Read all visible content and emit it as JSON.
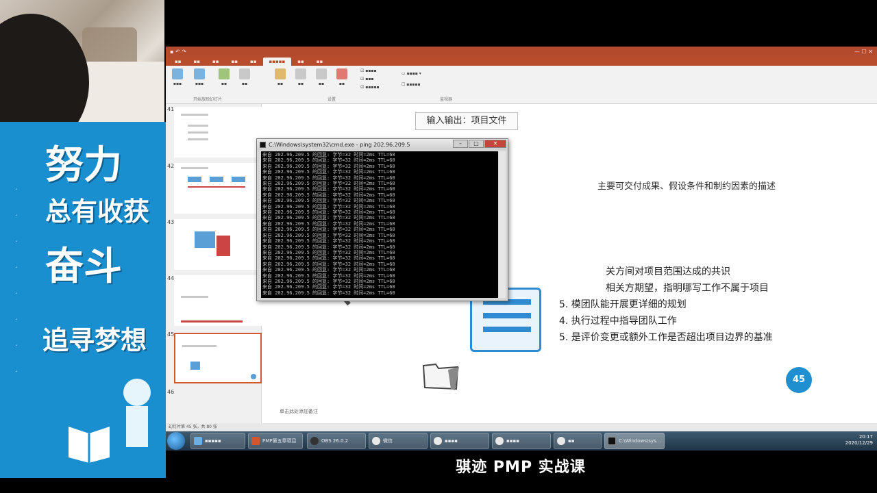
{
  "banner": {
    "line1": "努力",
    "line2": "总有收获",
    "line3": "奋斗",
    "line4": "追寻梦想"
  },
  "ppt": {
    "ribbon_groups": [
      "开始放映幻灯片",
      "设置",
      "监视器"
    ],
    "thumbnail_numbers": [
      "41",
      "42",
      "43",
      "44",
      "45",
      "46"
    ],
    "notes_hint": "单击此处添加备注",
    "status_text": "幻灯片第 45 张，共 80 张"
  },
  "slide": {
    "header": "输入输出：项目文件",
    "desc": "主要可交付成果、假设条件和制约因素的描述",
    "items": [
      "关方间对项目范围达成的共识",
      "相关方期望，指明哪写工作不属于项目",
      "5. 模团队能开展更详细的规划",
      "4. 执行过程中指导团队工作",
      "5. 是评价变更或额外工作是否超出项目边界的基准"
    ],
    "page_number": "45"
  },
  "cmd": {
    "title": "C:\\Windows\\system32\\cmd.exe - ping  202.96.209.5",
    "lines": [
      "来自 202.96.209.5 的回复: 字节=32 时间=2ms TTL=60",
      "来自 202.96.209.5 的回复: 字节=32 时间=2ms TTL=60",
      "来自 202.96.209.5 的回复: 字节=32 时间=2ms TTL=60",
      "来自 202.96.209.5 的回复: 字节=32 时间=2ms TTL=60",
      "来自 202.96.209.5 的回复: 字节=32 时间=2ms TTL=60",
      "来自 202.96.209.5 的回复: 字节=32 时间=2ms TTL=60",
      "来自 202.96.209.5 的回复: 字节=32 时间=2ms TTL=60",
      "来自 202.96.209.5 的回复: 字节=32 时间=2ms TTL=60",
      "来自 202.96.209.5 的回复: 字节=32 时间=2ms TTL=60",
      "来自 202.96.209.5 的回复: 字节=32 时间=2ms TTL=60",
      "来自 202.96.209.5 的回复: 字节=32 时间=2ms TTL=60",
      "来自 202.96.209.5 的回复: 字节=32 时间=2ms TTL=60",
      "来自 202.96.209.5 的回复: 字节=32 时间=2ms TTL=60",
      "来自 202.96.209.5 的回复: 字节=32 时间=2ms TTL=60",
      "来自 202.96.209.5 的回复: 字节=32 时间=2ms TTL=60",
      "来自 202.96.209.5 的回复: 字节=32 时间=2ms TTL=60",
      "来自 202.96.209.5 的回复: 字节=32 时间=2ms TTL=60",
      "来自 202.96.209.5 的回复: 字节=32 时间=2ms TTL=60",
      "来自 202.96.209.5 的回复: 字节=32 时间=2ms TTL=60",
      "来自 202.96.209.5 的回复: 字节=32 时间=2ms TTL=60",
      "来自 202.96.209.5 的回复: 字节=32 时间=2ms TTL=60",
      "来自 202.96.209.5 的回复: 字节=32 时间=2ms TTL=60",
      "来自 202.96.209.5 的回复: 字节=32 时间=2ms TTL=60",
      "来自 202.96.209.5 的回复: 字节=32 时间=2ms TTL=60",
      "来自 202.96.209.5 的回复: 字节=32 时间=2ms TTL=60"
    ]
  },
  "taskbar": {
    "tasks": [
      "OBS 26.0.2",
      "PMP第五章项目",
      "微信",
      "C:\\Windows\\sys..."
    ],
    "time": "20:17",
    "date": "2020/12/29"
  },
  "subtitle": "骐迹 PMP 实战课"
}
